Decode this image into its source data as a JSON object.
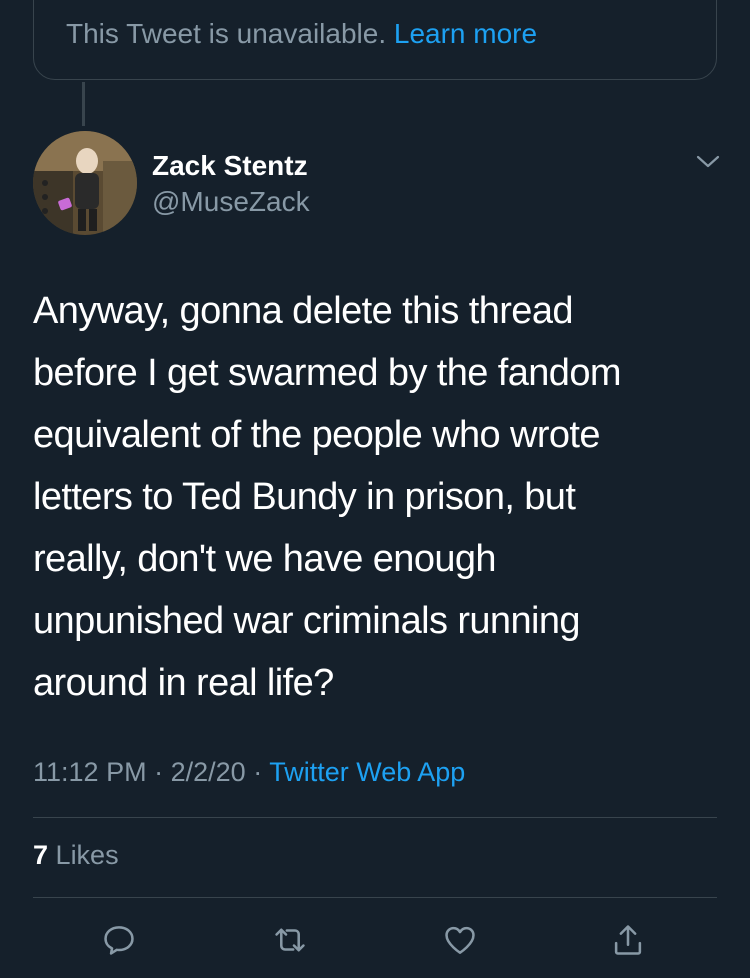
{
  "unavailable": {
    "text": "This Tweet is unavailable.",
    "link": "Learn more"
  },
  "author": {
    "name": "Zack Stentz",
    "handle": "@MuseZack"
  },
  "tweet": {
    "lines": [
      "Anyway, gonna delete this thread",
      "before I get swarmed by the fandom",
      "equivalent of the people who wrote",
      "letters to Ted Bundy in prison, but",
      "really, don't we have enough",
      "unpunished war criminals running",
      "around in real life?"
    ],
    "time": "11:12 PM",
    "date": "2/2/20",
    "source": "Twitter Web App",
    "separator": "·"
  },
  "stats": {
    "likes_count": "7",
    "likes_label": "Likes"
  },
  "actions": {
    "reply": "reply-icon",
    "retweet": "retweet-icon",
    "like": "heart-icon",
    "share": "share-icon"
  },
  "colors": {
    "background": "#15202b",
    "text": "#ffffff",
    "secondary": "#8899a6",
    "accent": "#1da1f2",
    "border": "#38444d"
  }
}
